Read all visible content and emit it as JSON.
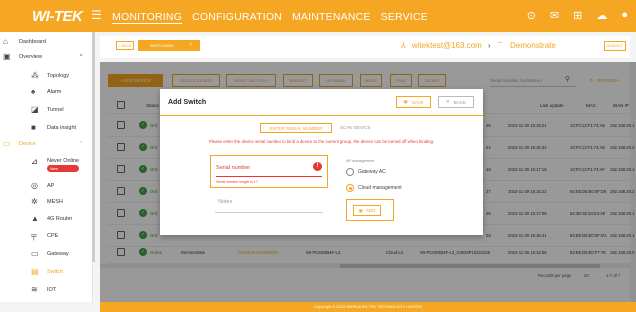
{
  "brand": {
    "logo": "WI-TEK",
    "accent": "#f5a623"
  },
  "topnav": {
    "monitoring": "MONITORING",
    "configuration": "CONFIGURATION",
    "maintenance": "MAINTENANCE",
    "service": "SERVICE"
  },
  "sidebar": {
    "items": [
      {
        "label": "Dashboard",
        "icon": "home-icon"
      },
      {
        "label": "Overview",
        "icon": "overview-icon"
      },
      {
        "label": "Topology",
        "icon": "topology-icon"
      },
      {
        "label": "Alarm",
        "icon": "bell-icon"
      },
      {
        "label": "Tunnel",
        "icon": "tunnel-icon"
      },
      {
        "label": "Data insight",
        "icon": "insight-icon"
      },
      {
        "label": "Device",
        "icon": "device-icon"
      },
      {
        "label": "Never Online",
        "icon": "never-online-icon",
        "badge": "New"
      },
      {
        "label": "AP",
        "icon": "ap-icon"
      },
      {
        "label": "MESH",
        "icon": "mesh-icon"
      },
      {
        "label": "4G Router",
        "icon": "router-icon"
      },
      {
        "label": "CPE",
        "icon": "cpe-icon"
      },
      {
        "label": "Gateway",
        "icon": "gateway-icon"
      },
      {
        "label": "Switch",
        "icon": "switch-icon"
      },
      {
        "label": "IOT",
        "icon": "iot-icon"
      }
    ]
  },
  "breadcrumb": {
    "back": "< BACK",
    "current": "SWITCH/WISH"
  },
  "account": {
    "email": "witektest@163.com",
    "project": "Demonstrate",
    "signout": "SIGNOUT"
  },
  "toolbar": {
    "add": "+ ADD DEVICE",
    "delete": "DELETE DEVICE",
    "reset": "RESET FACTORY",
    "reboot": "REBOOT",
    "upgrade": "UPGRADE",
    "move": "MOVE",
    "ping": "PING",
    "telnet": "TELNET",
    "search_placeholder": "Serial number, hostname / ",
    "refresh": "REFRESH"
  },
  "table": {
    "headers": {
      "status": "Status",
      "last_update": "Last update",
      "mac": "MAC",
      "wan_ip": "WAN IP"
    },
    "rows": [
      {
        "status": "Onli",
        "date": "2023-11-29 15:19:21",
        "mac": "10:F0:13:F1:74:AE",
        "ip": "192.168.20.1"
      },
      {
        "status": "Onli",
        "date": "2023-11-29 15:16:32",
        "mac": "10:F0:13:F1:74:AE",
        "ip": "192.168.20.2"
      },
      {
        "status": "Onli",
        "date": "2023-11-29 15:17:15",
        "mac": "10:F0:13:F1:74:AF",
        "ip": "192.168.20.1"
      },
      {
        "status": "Onli",
        "date": "2023-11-29 15:16:22",
        "mac": "84:E5:D8:E0:0F:D6",
        "ip": "192.168.20.2"
      },
      {
        "status": "Onli",
        "date": "2023-11-29 15:17:06",
        "mac": "54:3D:92:34:E4:39",
        "ip": "192.168.20.1"
      },
      {
        "status": "Onli",
        "date": "2023-11-29 15:16:41",
        "mac": "84:E5:D8:E0:0F:DA",
        "ip": "192.168.20.1"
      }
    ],
    "last_row": {
      "status": "Online",
      "project": "Demonstrate",
      "serial": "SWSS4F2023060001",
      "model": "WI-PCMS554F-L3",
      "mode": "Cloud-L3",
      "version": "WI-PCMS554F-L3_V3033P10231025",
      "date": "2023-11-29 15:15:56",
      "mac": "84:E5:D8:E0:F7:76",
      "ip": "192.168.20.0"
    },
    "row_prefixes": [
      "28",
      "24",
      "18",
      "27",
      "28",
      "28"
    ],
    "pager_label": "Records per page",
    "pager_size": "20",
    "pager_range": "1-7 of 7"
  },
  "footer": "Copyright © 2022 WIRELESS-TEK TECHNOLOGY LIMITED",
  "modal": {
    "title": "Add Switch",
    "save": "SAVE",
    "back": "BACK",
    "tab_serial": "ENTER SERIAL NUMBER",
    "tab_scan": "SCAN DEVICE",
    "warning": "Please enter the device serial number to bind a device to the current group, the device can be turned off when binding.",
    "serial_label": "Serial number",
    "serial_error": "Serial number length is 17.",
    "notes_label": "Notes",
    "ap_management": "AP management",
    "gateway_ac": "Gateway AC",
    "cloud_management": "Cloud management",
    "add": "ADD"
  }
}
